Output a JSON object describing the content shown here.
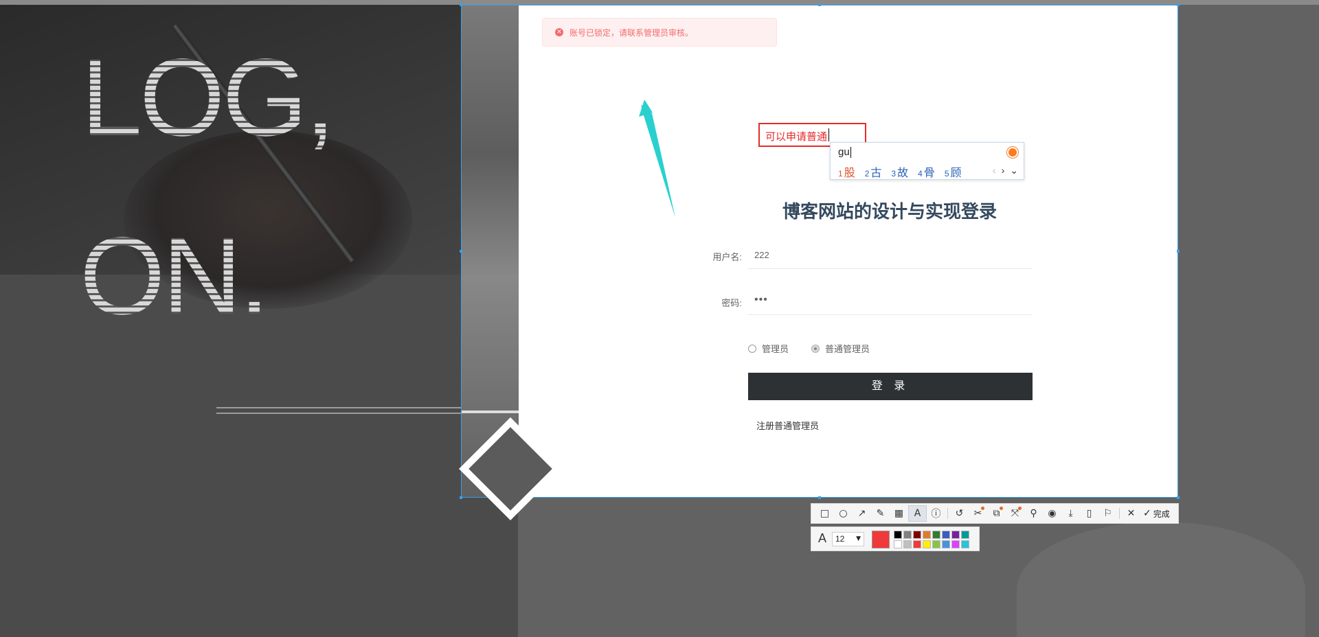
{
  "background": {
    "big_text_1": "LOG,",
    "big_text_2": "ON."
  },
  "alert": {
    "icon": "error-circle-icon",
    "text": "账号已锁定，请联系管理员审核。"
  },
  "annotation": {
    "text": "可以申请普通",
    "color": "#e52a2a"
  },
  "ime": {
    "input": "gu",
    "candidates": [
      {
        "num": "1",
        "text": "股"
      },
      {
        "num": "2",
        "text": "古"
      },
      {
        "num": "3",
        "text": "故"
      },
      {
        "num": "4",
        "text": "骨"
      },
      {
        "num": "5",
        "text": "顾"
      }
    ],
    "prev": "‹",
    "next": "›",
    "expand": "⌄"
  },
  "login": {
    "title": "博客网站的设计与实现登录",
    "username_label": "用户名:",
    "username_value": "222",
    "password_label": "密码:",
    "password_value": "•••",
    "role_options": [
      "管理员",
      "普通管理员"
    ],
    "role_selected": "普通管理员",
    "login_button": "登 录",
    "register_link": "注册普通管理员"
  },
  "toolbar": {
    "tools": [
      "rectangle-icon",
      "ellipse-icon",
      "arrow-icon",
      "pen-icon",
      "mosaic-icon",
      "text-icon",
      "number-icon",
      "undo-icon",
      "cut-icon",
      "ocr-icon",
      "scroll-capture-icon",
      "pin-icon",
      "record-icon",
      "download-icon",
      "phone-icon",
      "bookmark-icon",
      "close-icon"
    ],
    "done_label": "完成"
  },
  "text_options": {
    "font_label": "A",
    "font_size": "12",
    "current_color": "#f03a3a",
    "palette": [
      "#000000",
      "#808080",
      "#800000",
      "#e07a30",
      "#2e7d32",
      "#3b5cc4",
      "#7b1fa2",
      "#009999",
      "#ffffff",
      "#c0c0c0",
      "#f03a3a",
      "#ffee00",
      "#8bc34a",
      "#4a90e2",
      "#e040fb",
      "#26c6da"
    ]
  }
}
